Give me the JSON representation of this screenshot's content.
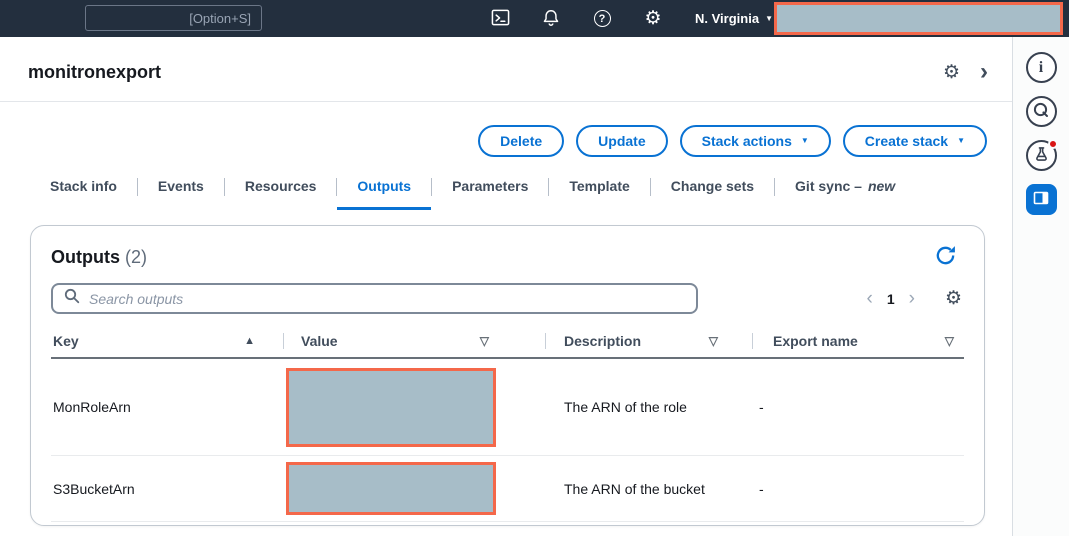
{
  "topbar": {
    "search_shortcut": "[Option+S]",
    "region": "N. Virginia"
  },
  "header": {
    "title": "monitronexport"
  },
  "actions": {
    "delete_label": "Delete",
    "update_label": "Update",
    "stack_actions_label": "Stack actions",
    "create_stack_label": "Create stack"
  },
  "tabs": [
    {
      "label": "Stack info"
    },
    {
      "label": "Events"
    },
    {
      "label": "Resources"
    },
    {
      "label": "Outputs",
      "active": true
    },
    {
      "label": "Parameters"
    },
    {
      "label": "Template"
    },
    {
      "label": "Change sets"
    },
    {
      "label": "Git sync –",
      "suffix": "new"
    }
  ],
  "outputs_panel": {
    "title": "Outputs",
    "count": "(2)",
    "search_placeholder": "Search outputs",
    "page_number": "1",
    "columns": {
      "key": "Key",
      "value": "Value",
      "description": "Description",
      "export_name": "Export name"
    },
    "rows": [
      {
        "key": "MonRoleArn",
        "value_redacted": true,
        "description": "The ARN of the role",
        "export_name": "-"
      },
      {
        "key": "S3BucketArn",
        "value_redacted": true,
        "description": "The ARN of the bucket",
        "export_name": "-"
      }
    ]
  },
  "icons": {
    "gear": "⚙",
    "caret_down": "▼",
    "sort_asc": "▲",
    "sort_desc": "▽",
    "chevron_left": "‹",
    "chevron_right": "›",
    "header_chevron": "›",
    "question": "?",
    "info": "i"
  },
  "colors": {
    "topbar_bg": "#232f3e",
    "accent_blue": "#0972d3",
    "redaction_border": "#f4684a",
    "redaction_fill": "#a7bdc8"
  }
}
